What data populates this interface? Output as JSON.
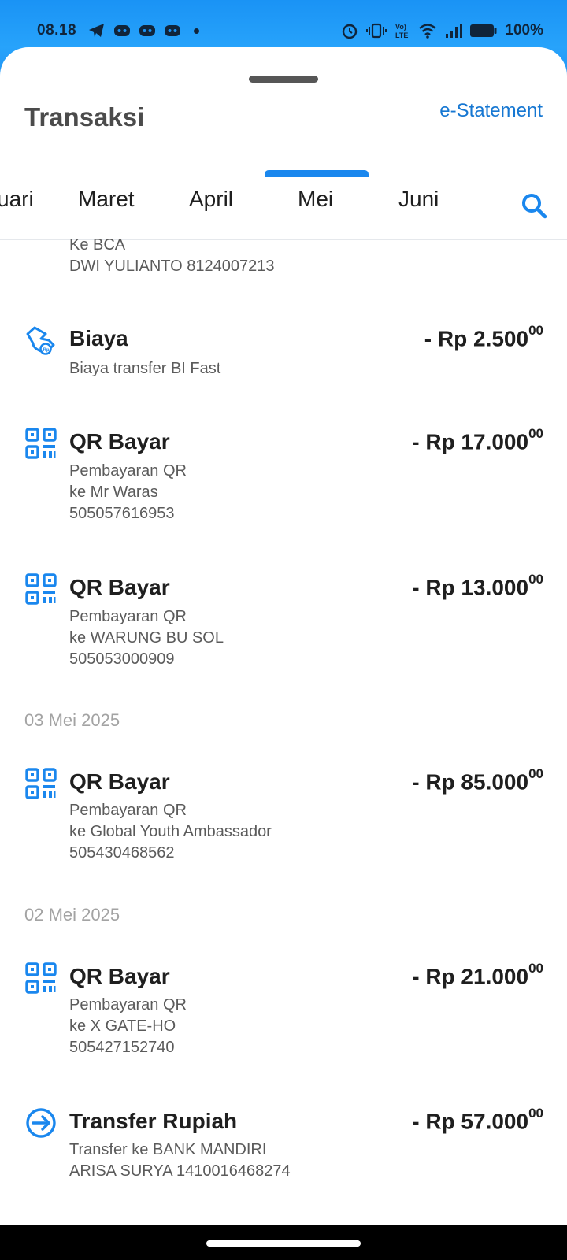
{
  "status_bar": {
    "time": "08.18",
    "battery": "100%",
    "left_icons": [
      "telegram-icon",
      "discord-icon",
      "discord-icon",
      "discord-icon",
      "dot-icon"
    ],
    "right_icons": [
      "alarm-icon",
      "vibrate-icon",
      "volte-icon",
      "wifi-icon",
      "signal-icon",
      "battery-icon"
    ]
  },
  "header": {
    "title": "Transaksi",
    "estatement": "e-Statement"
  },
  "tabs": {
    "items": [
      "uari",
      "Maret",
      "April",
      "Mei",
      "Juni"
    ],
    "selected": "Mei",
    "search_icon": "search-icon"
  },
  "partial_txn": {
    "lines": [
      "Ke BCA",
      "DWI YULIANTO 8124007213"
    ]
  },
  "transactions": [
    {
      "icon": "fee-icon",
      "title": "Biaya",
      "amount": "- Rp 2.500",
      "cents": "00",
      "lines": [
        "Biaya transfer BI Fast"
      ]
    },
    {
      "icon": "qr-icon",
      "title": "QR Bayar",
      "amount": "- Rp 17.000",
      "cents": "00",
      "lines": [
        "Pembayaran QR",
        "ke Mr Waras",
        "505057616953"
      ]
    },
    {
      "icon": "qr-icon",
      "title": "QR Bayar",
      "amount": "- Rp 13.000",
      "cents": "00",
      "lines": [
        "Pembayaran QR",
        "ke WARUNG BU SOL",
        "505053000909"
      ]
    }
  ],
  "date_groups": [
    {
      "date": "03 Mei 2025",
      "transactions": [
        {
          "icon": "qr-icon",
          "title": "QR Bayar",
          "amount": "- Rp 85.000",
          "cents": "00",
          "lines": [
            "Pembayaran QR",
            "ke Global Youth Ambassador",
            "505430468562"
          ]
        }
      ]
    },
    {
      "date": "02 Mei 2025",
      "transactions": [
        {
          "icon": "qr-icon",
          "title": "QR Bayar",
          "amount": "- Rp 21.000",
          "cents": "00",
          "lines": [
            "Pembayaran QR",
            "ke X GATE-HO",
            "505427152740"
          ]
        },
        {
          "icon": "transfer-icon",
          "title": "Transfer Rupiah",
          "amount": "- Rp 57.000",
          "cents": "00",
          "lines": [
            "Transfer ke BANK MANDIRI",
            "ARISA SURYA 1410016468274"
          ]
        }
      ]
    }
  ],
  "colors": {
    "accent": "#1a87ee",
    "status_bar": "#1a93f5",
    "text": "#1f1f1f",
    "muted": "#5b5b5b",
    "date": "#a3a3a3"
  }
}
